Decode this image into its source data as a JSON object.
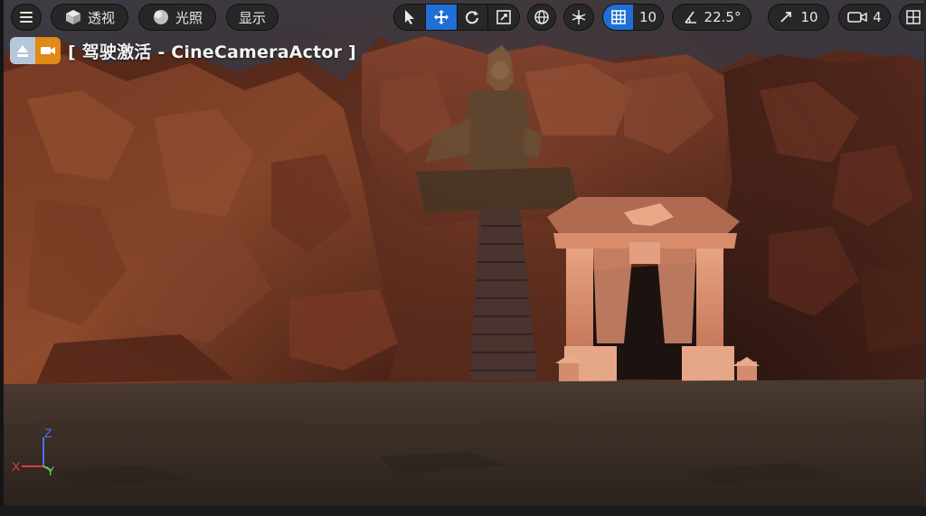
{
  "toolbar_left": {
    "menu_icon": "hamburger-icon",
    "perspective_label": "透视",
    "lit_label": "光照",
    "show_label": "显示"
  },
  "toolbar_right": {
    "grid_snap_value": "10",
    "rotation_snap_value": "22.5°",
    "scale_snap_value": "10",
    "camera_speed_value": "4",
    "active_color": "#1f6fd6"
  },
  "pilot": {
    "label": "[ 驾驶激活 - CineCameraActor ]"
  },
  "axes": {
    "x_label": "X",
    "y_label": "Y",
    "z_label": "Z",
    "x_color": "#e23b3b",
    "y_color": "#5fd14b",
    "z_color": "#4a74e6"
  }
}
